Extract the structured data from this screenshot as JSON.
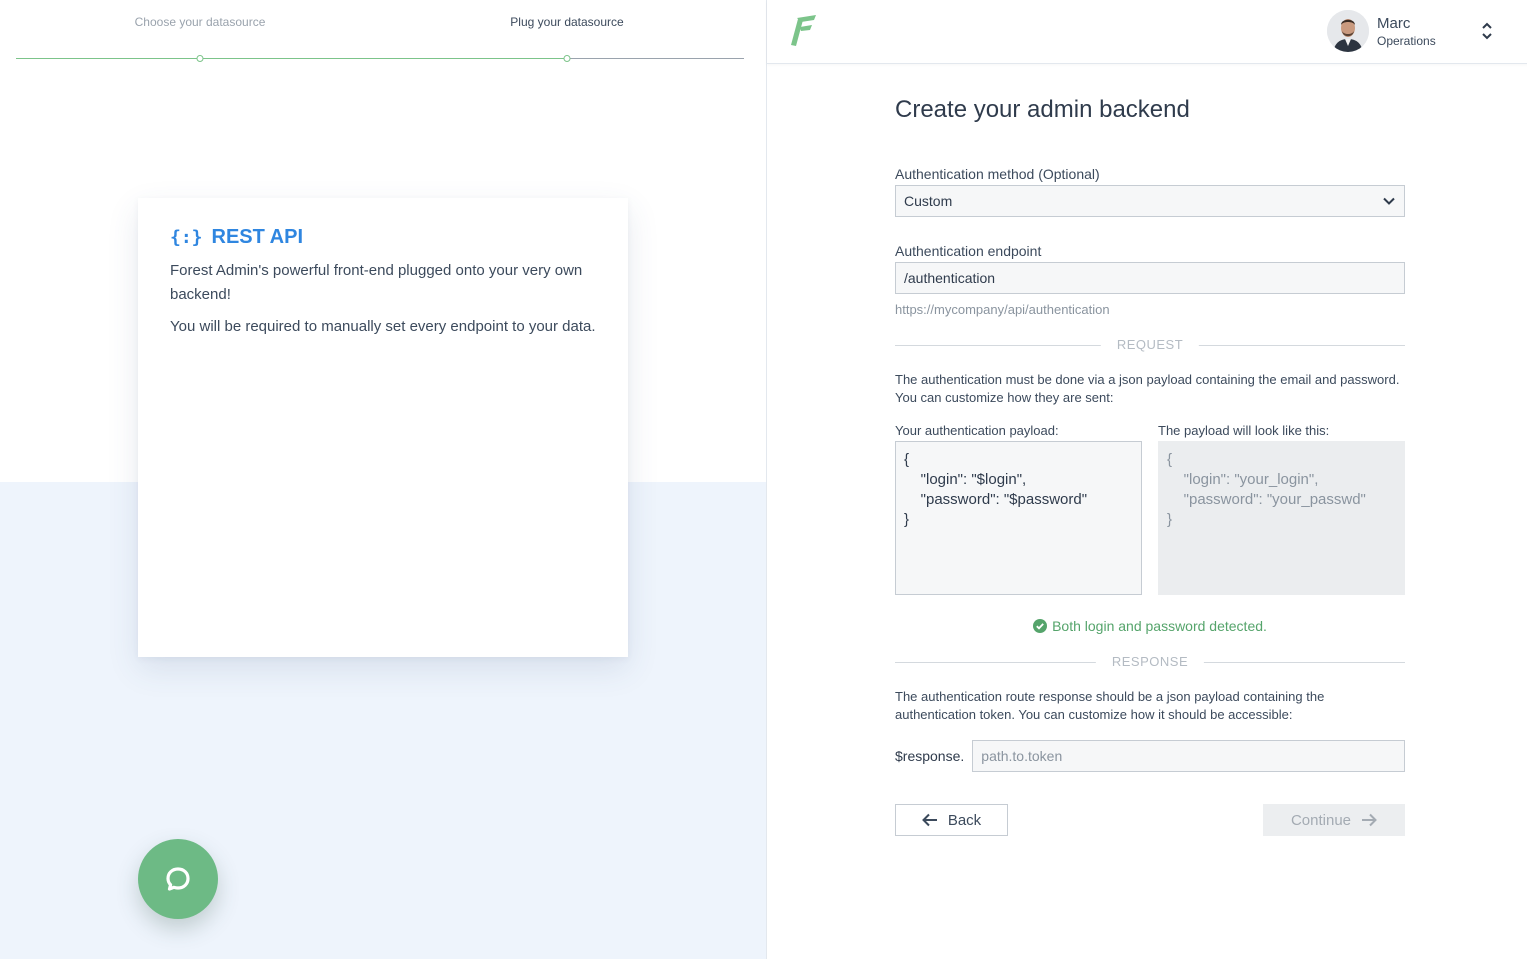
{
  "stepper": {
    "steps": [
      {
        "label": "Choose your datasource",
        "state": "done"
      },
      {
        "label": "Plug your datasource",
        "state": "active"
      }
    ]
  },
  "card": {
    "icon": "braces-icon",
    "title": "REST API",
    "paragraphs": [
      "Forest Admin's powerful front-end plugged onto your very own backend!",
      "You will be required to manually set every endpoint to your data."
    ]
  },
  "chat": {
    "icon": "chat-bubble-icon",
    "color": "#6dba85"
  },
  "header": {
    "logo": "forest-admin-logo",
    "user": {
      "name": "Marc",
      "role": "Operations"
    }
  },
  "form": {
    "title": "Create your admin backend",
    "auth_method": {
      "label": "Authentication method (Optional)",
      "value": "Custom"
    },
    "auth_endpoint": {
      "label": "Authentication endpoint",
      "value": "/authentication",
      "full_url": "https://mycompany/api/authentication"
    },
    "request": {
      "section_label": "REQUEST",
      "description": "The authentication must be done via a json payload containing the email and password. You can customize how they are sent:",
      "payload_label": "Your authentication payload:",
      "payload_value": "{\n    \"login\": \"$login\",\n    \"password\": \"$password\"\n}",
      "preview_label": "The payload will look like this:",
      "preview_value": "{\n    \"login\": \"your_login\",\n    \"password\": \"your_passwd\"\n}",
      "success_message": "Both login and password detected."
    },
    "response": {
      "section_label": "RESPONSE",
      "description": "The authentication route response should be a json payload containing the authentication token. You can customize how it should be accessible:",
      "prefix": "$response.",
      "placeholder": "path.to.token",
      "value": ""
    },
    "back_label": "Back",
    "continue_label": "Continue"
  },
  "colors": {
    "accent_blue": "#2f86e0",
    "success_green": "#55a46b",
    "stepper_green": "#7cc48a"
  }
}
